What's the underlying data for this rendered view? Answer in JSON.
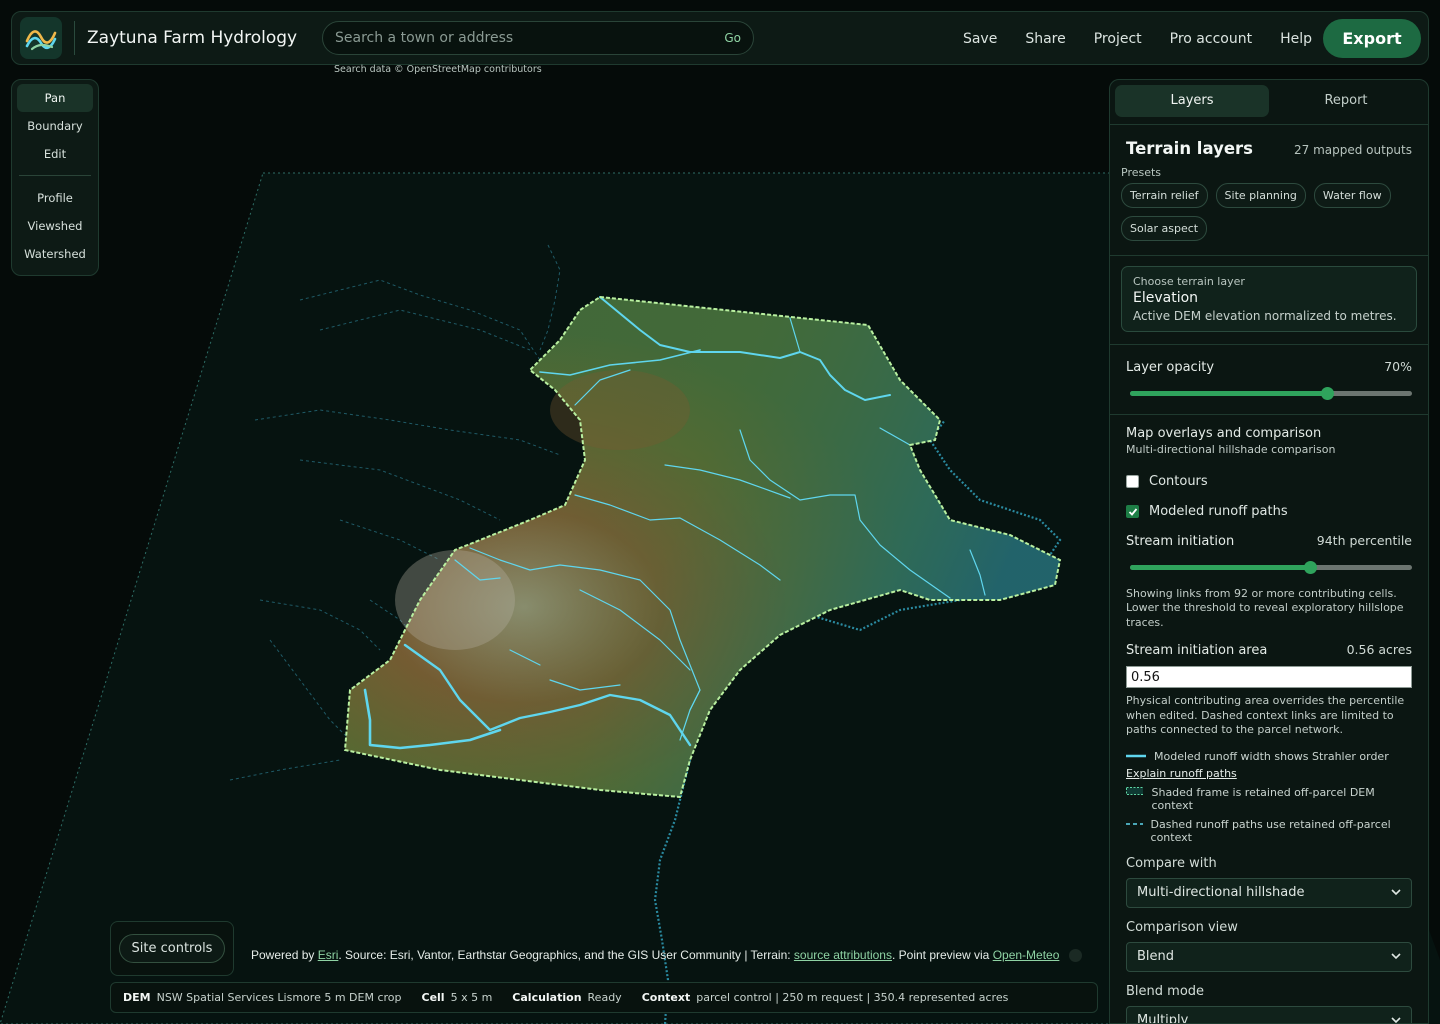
{
  "app": {
    "title": "Zaytuna Farm Hydrology Si",
    "logo_icon": "waves-logo-icon"
  },
  "search": {
    "placeholder": "Search a town or address",
    "go_label": "Go",
    "attribution": "Search data © OpenStreetMap contributors"
  },
  "nav": {
    "items": [
      "Save",
      "Share",
      "Project",
      "Pro account",
      "Help"
    ],
    "export_label": "Export"
  },
  "tools": {
    "group1": [
      "Pan",
      "Boundary",
      "Edit"
    ],
    "group2": [
      "Profile",
      "Viewshed",
      "Watershed"
    ],
    "active": "Pan"
  },
  "panel": {
    "tabs": [
      "Layers",
      "Report"
    ],
    "active_tab": "Layers",
    "terrain": {
      "title": "Terrain layers",
      "count": "27 mapped outputs",
      "presets_label": "Presets",
      "presets": [
        "Terrain relief",
        "Site planning",
        "Water flow",
        "Solar aspect"
      ],
      "choose_label": "Choose terrain layer",
      "choose_value": "Elevation",
      "choose_desc": "Active DEM elevation normalized to metres."
    },
    "opacity": {
      "label": "Layer opacity",
      "value_text": "70%",
      "value": 0.7
    },
    "overlays": {
      "title": "Map overlays and comparison",
      "subtitle": "Multi-directional hillshade comparison",
      "contours_label": "Contours",
      "contours_checked": false,
      "runoff_label": "Modeled runoff paths",
      "runoff_checked": true,
      "stream_init_label": "Stream initiation",
      "stream_init_value": "94th percentile",
      "stream_init_fraction": 0.64,
      "stream_note": "Showing links from 92 or more contributing cells. Lower the threshold to reveal exploratory hillslope traces.",
      "area_label": "Stream initiation area",
      "area_value_text": "0.56 acres",
      "area_input": "0.56",
      "area_note": "Physical contributing area overrides the percentile when edited. Dashed context links are limited to paths connected to the parcel network.",
      "legend_width": "Modeled runoff width shows Strahler order",
      "explain_link": "Explain runoff paths",
      "legend_frame": "Shaded frame is retained off-parcel DEM context",
      "legend_dashed": "Dashed runoff paths use retained off-parcel context",
      "compare_label": "Compare with",
      "compare_value": "Multi-directional hillshade",
      "view_label": "Comparison view",
      "view_value": "Blend",
      "blend_label": "Blend mode",
      "blend_value": "Multiply"
    }
  },
  "bottom": {
    "site_controls": "Site controls",
    "attr_prefix": "Powered by ",
    "attr_esri": "Esri",
    "attr_mid": ". Source: Esri, Vantor, Earthstar Geographics, and the GIS User Community | Terrain: ",
    "attr_sources": "source attributions",
    "attr_mid2": ". Point preview via ",
    "attr_openmeteo": "Open-Meteo",
    "status": {
      "dem_label": "DEM",
      "dem_value": "NSW Spatial Services Lismore 5 m DEM crop",
      "cell_label": "Cell",
      "cell_value": "5 x 5 m",
      "calc_label": "Calculation",
      "calc_value": "Ready",
      "context_label": "Context",
      "context_value": "parcel control | 250 m request | 350.4 represented acres"
    }
  },
  "colors": {
    "accent": "#1d6a42",
    "runoff": "#5fd6ee",
    "boundary": "#b9f0a0",
    "panel_bg": "#0b1612"
  }
}
